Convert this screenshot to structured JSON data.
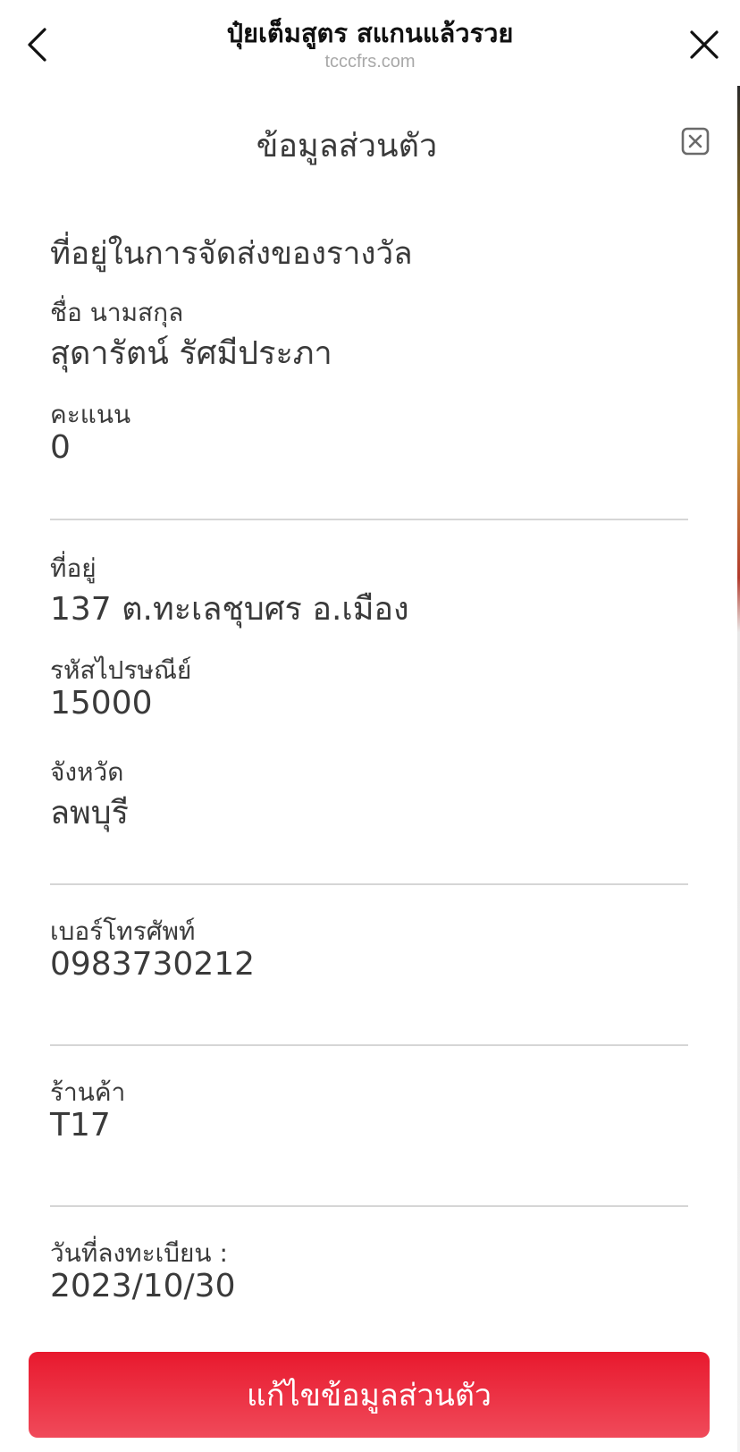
{
  "header": {
    "title": "ปุ๋ยเต็มสูตร สแกนแล้วรวย",
    "url": "tcccfrs.com",
    "back_icon": "chevron-left-icon",
    "close_icon": "close-x-icon"
  },
  "panel": {
    "title": "ข้อมูลส่วนตัว",
    "close_icon": "close-box-icon",
    "section_heading": "ที่อยู่ในการจัดส่งของรางวัล",
    "fields": {
      "name_label": "ชื่อ นามสกุล",
      "name_value": "สุดารัตน์ รัศมีประภา",
      "points_label": "คะแนน",
      "points_value": "0",
      "address_label": "ที่อยู่",
      "address_value": "137 ต.ทะเลชุบศร อ.เมือง",
      "postcode_label": "รหัสไปรษณีย์",
      "postcode_value": "15000",
      "province_label": "จังหวัด",
      "province_value": "ลพบุรี",
      "phone_label": "เบอร์โทรศัพท์",
      "phone_value": "0983730212",
      "store_label": "ร้านค้า",
      "store_value": "T17",
      "regdate_label": "วันที่ลงทะเบียน :",
      "regdate_value": "2023/10/30"
    },
    "edit_button_label": "แก้ไขข้อมูลส่วนตัว"
  },
  "colors": {
    "accent": "#e8192e",
    "text": "#3a3a3a",
    "divider": "#d6d6d6",
    "url": "#a8a8a8"
  }
}
